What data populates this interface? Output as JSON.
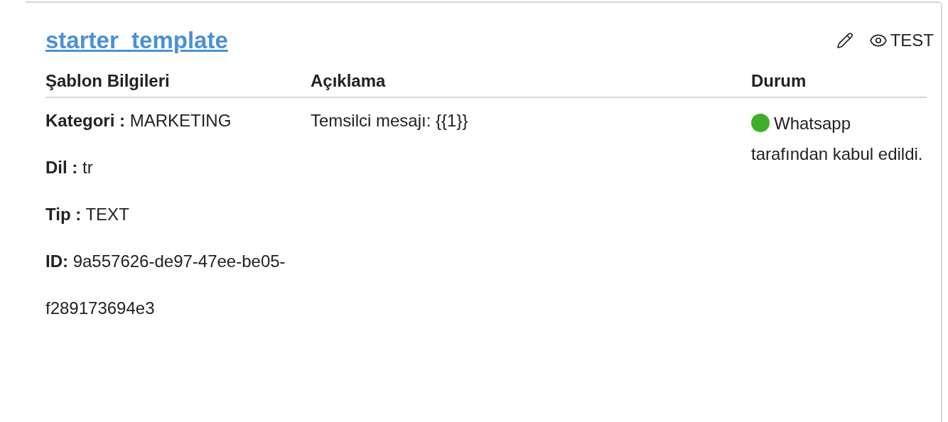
{
  "template": {
    "name": "starter_template",
    "actions": {
      "test_label": "TEST"
    }
  },
  "columns": [
    "Şablon Bilgileri",
    "Açıklama",
    "Durum"
  ],
  "info": [
    {
      "label": "Kategori :",
      "value": "MARKETING"
    },
    {
      "label": "Dil :",
      "value": "tr"
    },
    {
      "label": "Tip :",
      "value": "TEXT"
    },
    {
      "label": "ID:",
      "value": "9a557626-de97-47ee-be05-f289173694e3"
    }
  ],
  "description": "Temsilci mesajı: {{1}}",
  "status": {
    "color": "#3fae2a",
    "text": "Whatsapp tarafından kabul edildi."
  }
}
